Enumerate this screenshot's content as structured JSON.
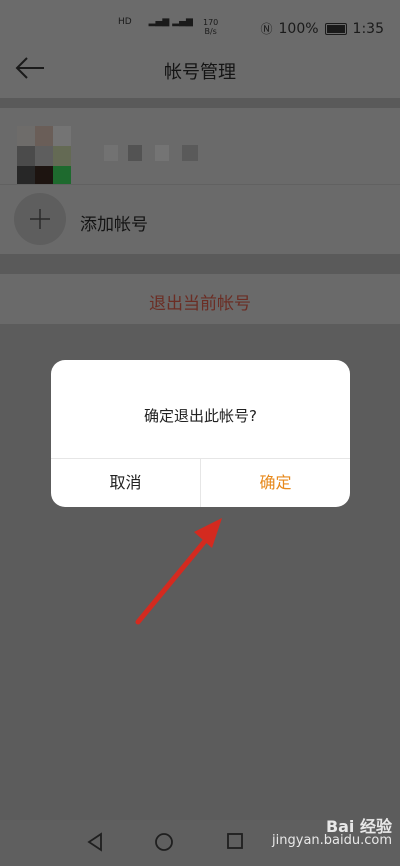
{
  "status_bar": {
    "sim_labels": "HD ",
    "network_speed_value": "170",
    "network_speed_unit": "B/s",
    "battery": "100%",
    "time": "1:35"
  },
  "header": {
    "title": "帐号管理"
  },
  "account_list": {
    "add_account_label": "添加帐号"
  },
  "logout": {
    "label": "退出当前帐号"
  },
  "dialog": {
    "message": "确定退出此帐号?",
    "cancel_label": "取消",
    "confirm_label": "确定"
  },
  "watermark": {
    "brand": "Bai 经验",
    "url": "jingyan.baidu.com"
  },
  "colors": {
    "accent_orange": "#e7891c",
    "annotation_arrow": "#d42a1f",
    "logout_text": "#6b2d24"
  }
}
